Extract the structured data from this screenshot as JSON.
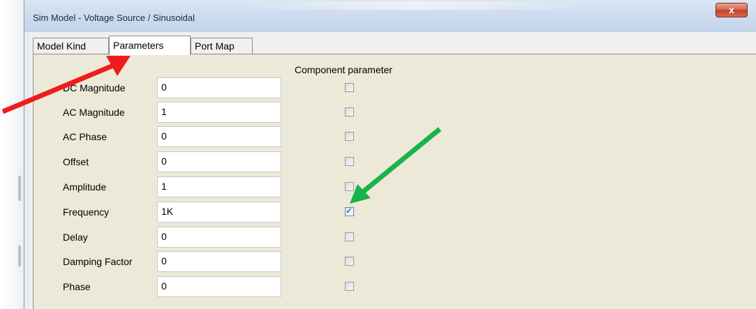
{
  "window": {
    "title": "Sim Model - Voltage Source / Sinusoidal",
    "close_glyph": "x"
  },
  "tabs": [
    {
      "label": "Model Kind",
      "active": false
    },
    {
      "label": "Parameters",
      "active": true
    },
    {
      "label": "Port Map",
      "active": false
    }
  ],
  "panel": {
    "column_header": "Component parameter",
    "rows": [
      {
        "label": "DC Magnitude",
        "value": "0",
        "component": false
      },
      {
        "label": "AC Magnitude",
        "value": "1",
        "component": false
      },
      {
        "label": "AC Phase",
        "value": "0",
        "component": false
      },
      {
        "label": "Offset",
        "value": "0",
        "component": false
      },
      {
        "label": "Amplitude",
        "value": "1",
        "component": false
      },
      {
        "label": "Frequency",
        "value": "1K",
        "component": true
      },
      {
        "label": "Delay",
        "value": "0",
        "component": false
      },
      {
        "label": "Damping Factor",
        "value": "0",
        "component": false
      },
      {
        "label": "Phase",
        "value": "0",
        "component": false
      }
    ]
  },
  "annotations": {
    "red_arrow_color": "#ee1c1c",
    "green_arrow_color": "#19b24b"
  },
  "icons": {
    "close": "close-icon",
    "check": "check-icon"
  }
}
